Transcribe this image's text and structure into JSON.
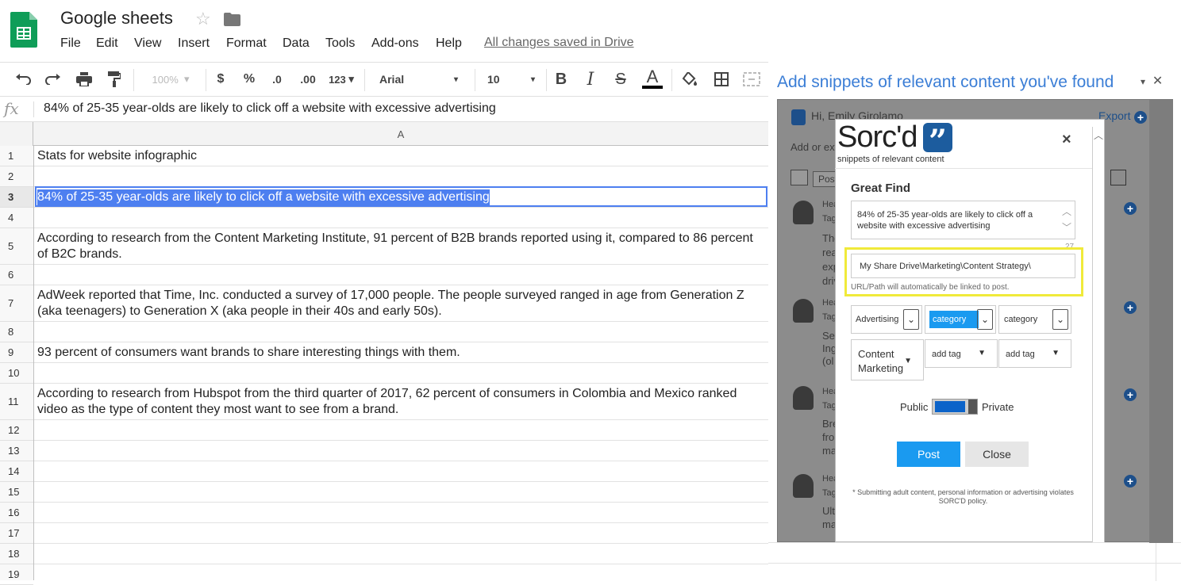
{
  "app": {
    "title": "Google sheets",
    "saved_status": "All changes saved in Drive"
  },
  "menu": [
    "File",
    "Edit",
    "View",
    "Insert",
    "Format",
    "Data",
    "Tools",
    "Add-ons",
    "Help"
  ],
  "toolbar": {
    "zoom": "100%",
    "currency": "$",
    "percent": "%",
    "dec_decrease": ".0",
    "dec_increase": ".00",
    "more_formats": "123",
    "font": "Arial",
    "font_size": "10",
    "bold": "B",
    "italic": "I",
    "strike": "S",
    "text_color": "A"
  },
  "formula_bar": {
    "fx": "fx",
    "value": "84% of 25-35 year-olds are likely to click off a website with excessive advertising"
  },
  "grid": {
    "column": "A",
    "rows": [
      {
        "n": "1",
        "text": "Stats for website infographic"
      },
      {
        "n": "2",
        "text": ""
      },
      {
        "n": "3",
        "text": "84% of 25-35 year-olds are likely to click off a website with excessive advertising"
      },
      {
        "n": "4",
        "text": ""
      },
      {
        "n": "5",
        "text": "According to research from the Content Marketing Institute, 91 percent of B2B brands reported using it, compared to 86 percent of B2C brands."
      },
      {
        "n": "6",
        "text": ""
      },
      {
        "n": "7",
        "text": "AdWeek reported that Time, Inc. conducted a survey of 17,000 people. The people surveyed ranged in age from Generation Z (aka teenagers) to Generation X (aka people in their 40s and early 50s)."
      },
      {
        "n": "8",
        "text": ""
      },
      {
        "n": "9",
        "text": "93 percent of consumers want brands to share interesting things with them."
      },
      {
        "n": "10",
        "text": ""
      },
      {
        "n": "11",
        "text": "According to research from Hubspot from the third quarter of 2017, 62 percent of consumers in Colombia and Mexico ranked video as the type of content they most want to see from a brand."
      },
      {
        "n": "12",
        "text": ""
      },
      {
        "n": "13",
        "text": ""
      },
      {
        "n": "14",
        "text": ""
      },
      {
        "n": "15",
        "text": ""
      },
      {
        "n": "16",
        "text": ""
      },
      {
        "n": "17",
        "text": ""
      },
      {
        "n": "18",
        "text": ""
      },
      {
        "n": "19",
        "text": ""
      }
    ]
  },
  "panel": {
    "title": "Add snippets of relevant content you've  found",
    "greeting": "Hi, Emily Girolamo",
    "export": "Export",
    "add_or_ext": "Add or ext",
    "search_post": "Post",
    "items": [
      {
        "line1": "Hea",
        "line2": "Tag",
        "body": [
          "The",
          "rea",
          "exp",
          "driv"
        ]
      },
      {
        "line1": "Hea",
        "line2": "Tag",
        "body": [
          "See",
          "Ing",
          "(ol"
        ]
      },
      {
        "line1": "Hea",
        "line2": "Tag",
        "body": [
          "Bre",
          "fro",
          "ma"
        ]
      },
      {
        "line1": "Hea",
        "line2": "Tag",
        "body": [
          "Ult",
          "ma"
        ]
      }
    ]
  },
  "dialog": {
    "logo": "Sorc'd",
    "tagline": "snippets of relevant content",
    "close": "×",
    "heading": "Great Find",
    "snippet": "84% of 25-35 year-olds are likely to click off a website with excessive advertising",
    "char_count": "27",
    "url": "My Share Drive\\Marketing\\Content Strategy\\",
    "url_hint": "URL/Path will automatically be linked to post.",
    "categories": [
      "Advertising &",
      "category",
      "category"
    ],
    "tags": [
      "Content Marketing",
      "add tag",
      "add tag"
    ],
    "public_label": "Public",
    "private_label": "Private",
    "post_label": "Post",
    "close_label": "Close",
    "footnote": "* Submitting adult content, personal information or advertising violates SORC'D policy."
  },
  "colors": {
    "accent": "#4d7ff0",
    "panel_title": "#3b7ed6",
    "post": "#1a9af0",
    "highlight": "#f0ea3a"
  }
}
